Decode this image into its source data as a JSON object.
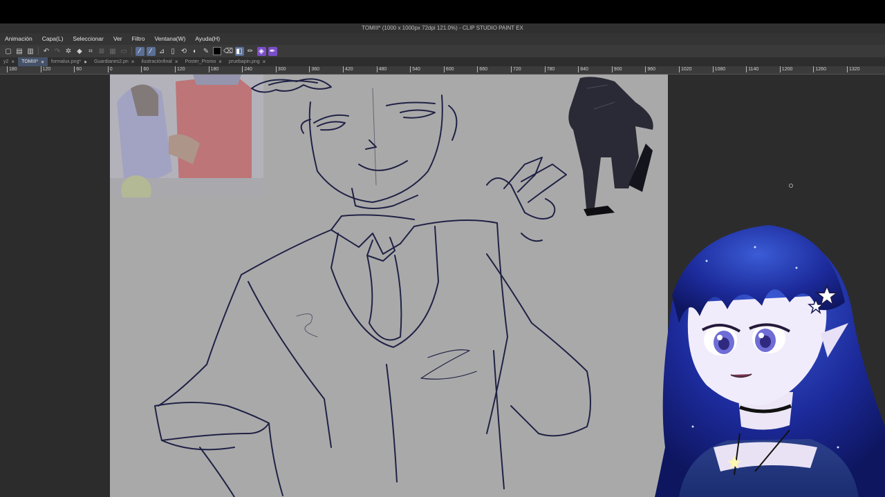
{
  "window": {
    "title": "TOMIII* (1000 x 1000px 72dpi 121.0%) - CLIP STUDIO PAINT EX"
  },
  "menu": {
    "items": [
      "Animación",
      "Capa(L)",
      "Seleccionar",
      "Ver",
      "Filtro",
      "Ventana(W)",
      "Ayuda(H)"
    ]
  },
  "toolbar": {
    "color_swatch": "#000000",
    "accent": "#5a6f95",
    "highlight": "#7b4ec9"
  },
  "tabs": [
    {
      "label": "y2",
      "active": false
    },
    {
      "label": "TOMIII*",
      "active": true
    },
    {
      "label": "formalux.png*",
      "active": false
    },
    {
      "label": "Guardianes2.pn",
      "active": false
    },
    {
      "label": "ilustraciónfinal",
      "active": false
    },
    {
      "label": "Poster_Promo",
      "active": false
    },
    {
      "label": "pruebapin.png",
      "active": false
    }
  ],
  "ruler": {
    "labels": [
      "180",
      "120",
      "60",
      "0",
      "60",
      "120",
      "180",
      "240",
      "300",
      "360",
      "420",
      "480",
      "540",
      "600",
      "660",
      "720",
      "780",
      "840",
      "900",
      "960",
      "1020",
      "1080",
      "1140",
      "1200",
      "1260",
      "1320"
    ]
  }
}
